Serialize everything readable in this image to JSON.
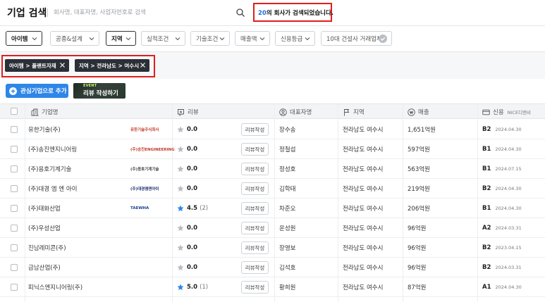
{
  "header": {
    "title": "기업 검색",
    "search_placeholder": "회사명, 대표자명, 사업자번호로 검색",
    "result_count": "20",
    "result_suffix": "의 회사가 검색되었습니다."
  },
  "filters": [
    {
      "label": "아이템",
      "active": true
    },
    {
      "label": "공종&설계",
      "active": false
    },
    {
      "label": "지역",
      "active": true
    },
    {
      "label": "실적조건",
      "active": false
    },
    {
      "label": "기술조건",
      "active": false
    },
    {
      "label": "매출액",
      "active": false
    },
    {
      "label": "신용등급",
      "active": false
    },
    {
      "label": "10대 건설사 거래업체",
      "active": false
    }
  ],
  "tags": [
    {
      "label": "아이템 > 플랜트자재"
    },
    {
      "label": "지역 > 전라남도 > 여수시"
    }
  ],
  "actions": {
    "add_interest": "관심기업으로 추가",
    "review_event_badge": "EVENT",
    "review_write": "리뷰 작성하기"
  },
  "table": {
    "columns": {
      "company": "기업명",
      "review": "리뷰",
      "ceo": "대표자명",
      "region": "지역",
      "sales": "매출",
      "credit": "신용",
      "credit_sub": "NICE디앤비"
    },
    "review_button": "리뷰작성",
    "rows": [
      {
        "company": "유한기술(주)",
        "logo_text": "유한기술주식회사",
        "logo_color": "#c0392b",
        "rating": "0.0",
        "review_count": "",
        "star_color": "#b6bbc2",
        "ceo": "장수송",
        "region": "전라남도 여수시",
        "sales": "1,651억원",
        "grade": "B2",
        "grade_date": "2024.04.30"
      },
      {
        "company": "(주)송진엔지니어링",
        "logo_text": "(주)송진ENGINEERING",
        "logo_color": "#c0392b",
        "rating": "0.0",
        "review_count": "",
        "star_color": "#b6bbc2",
        "ceo": "정철섭",
        "region": "전라남도 여수시",
        "sales": "597억원",
        "grade": "B1",
        "grade_date": "2024.04.30"
      },
      {
        "company": "(주)용호기계기술",
        "logo_text": "(주)용호기계기술",
        "logo_color": "#444444",
        "rating": "0.0",
        "review_count": "",
        "star_color": "#b6bbc2",
        "ceo": "정성호",
        "region": "전라남도 여수시",
        "sales": "563억원",
        "grade": "B1",
        "grade_date": "2024.07.15"
      },
      {
        "company": "(주)대경 엠 엔 아이",
        "logo_text": "(주)대경엠엔아이",
        "logo_color": "#1a2a6c",
        "rating": "0.0",
        "review_count": "",
        "star_color": "#b6bbc2",
        "ceo": "김학태",
        "region": "전라남도 여수시",
        "sales": "219억원",
        "grade": "B2",
        "grade_date": "2024.04.30"
      },
      {
        "company": "(주)태화산업",
        "logo_text": "TAEWHA",
        "logo_color": "#1d3f8f",
        "rating": "4.5",
        "review_count": "(2)",
        "star_color": "#2e86e8",
        "ceo": "차준오",
        "region": "전라남도 여수시",
        "sales": "206억원",
        "grade": "B1",
        "grade_date": "2024.04.30"
      },
      {
        "company": "(주)우성산업",
        "logo_text": "",
        "logo_color": "#444444",
        "rating": "0.0",
        "review_count": "",
        "star_color": "#b6bbc2",
        "ceo": "운성원",
        "region": "전라남도 여수시",
        "sales": "96억원",
        "grade": "A2",
        "grade_date": "2024.03.31"
      },
      {
        "company": "진남레미콘(주)",
        "logo_text": "",
        "logo_color": "#444444",
        "rating": "0.0",
        "review_count": "",
        "star_color": "#b6bbc2",
        "ceo": "장영보",
        "region": "전라남도 여수시",
        "sales": "96억원",
        "grade": "B2",
        "grade_date": "2023.04.15"
      },
      {
        "company": "금남산업(주)",
        "logo_text": "",
        "logo_color": "#444444",
        "rating": "0.0",
        "review_count": "",
        "star_color": "#b6bbc2",
        "ceo": "김석호",
        "region": "전라남도 여수시",
        "sales": "96억원",
        "grade": "B2",
        "grade_date": "2024.03.31"
      },
      {
        "company": "피닉스엔지니어링(주)",
        "logo_text": "",
        "logo_color": "#444444",
        "rating": "5.0",
        "review_count": "(1)",
        "star_color": "#2e86e8",
        "ceo": "황희원",
        "region": "전라남도 여수시",
        "sales": "87억원",
        "grade": "A1",
        "grade_date": "2024.04.30"
      },
      {
        "company": "",
        "logo_text": "",
        "logo_color": "#444444",
        "rating": "",
        "review_count": "",
        "star_color": "#b6bbc2",
        "ceo": "",
        "region": "",
        "sales": "",
        "grade": "",
        "grade_date": ""
      }
    ]
  }
}
